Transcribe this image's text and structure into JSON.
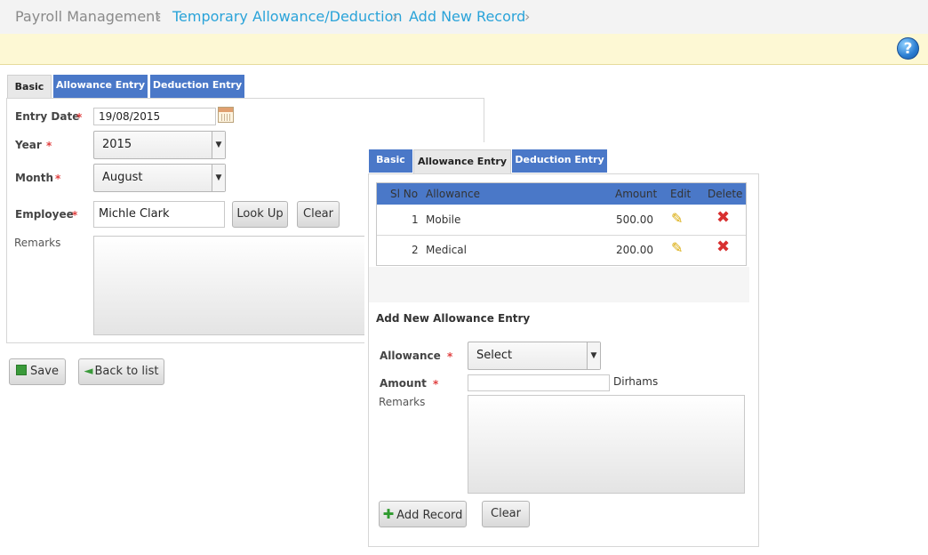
{
  "breadcrumb": [
    "Payroll Management",
    "Temporary Allowance/Deduction",
    "Add New Record"
  ],
  "help_label": "?",
  "main": {
    "tabs": [
      "Basic",
      "Allowance Entry",
      "Deduction Entry"
    ],
    "entry_date_label": "Entry Date",
    "entry_date_value": "19/08/2015",
    "year_label": "Year",
    "year_value": "2015",
    "month_label": "Month",
    "month_value": "August",
    "employee_label": "Employee",
    "employee_value": "Michle Clark",
    "lookup_label": "Look Up",
    "clear_label": "Clear",
    "remarks_label": "Remarks",
    "required_mark": "*",
    "save_label": "Save",
    "back_label": "Back to list"
  },
  "popup": {
    "tabs": [
      "Basic",
      "Allowance Entry",
      "Deduction Entry"
    ],
    "columns": [
      "Sl No",
      "Allowance",
      "Amount",
      "Edit",
      "Delete"
    ],
    "rows": [
      {
        "sl": "1",
        "allowance": "Mobile",
        "amount": "500.00"
      },
      {
        "sl": "2",
        "allowance": "Medical",
        "amount": "200.00"
      }
    ],
    "section_title": "Add New Allowance Entry",
    "allowance_label": "Allowance",
    "allowance_value": "Select",
    "amount_label": "Amount",
    "amount_value": "",
    "currency": "Dirhams",
    "remarks_label": "Remarks",
    "add_label": "Add Record",
    "clear_label": "Clear"
  },
  "colors": {
    "tab_blue": "#4a78c8",
    "link": "#2aa3d9",
    "required": "#e04040",
    "notice": "#fdf8d4"
  }
}
